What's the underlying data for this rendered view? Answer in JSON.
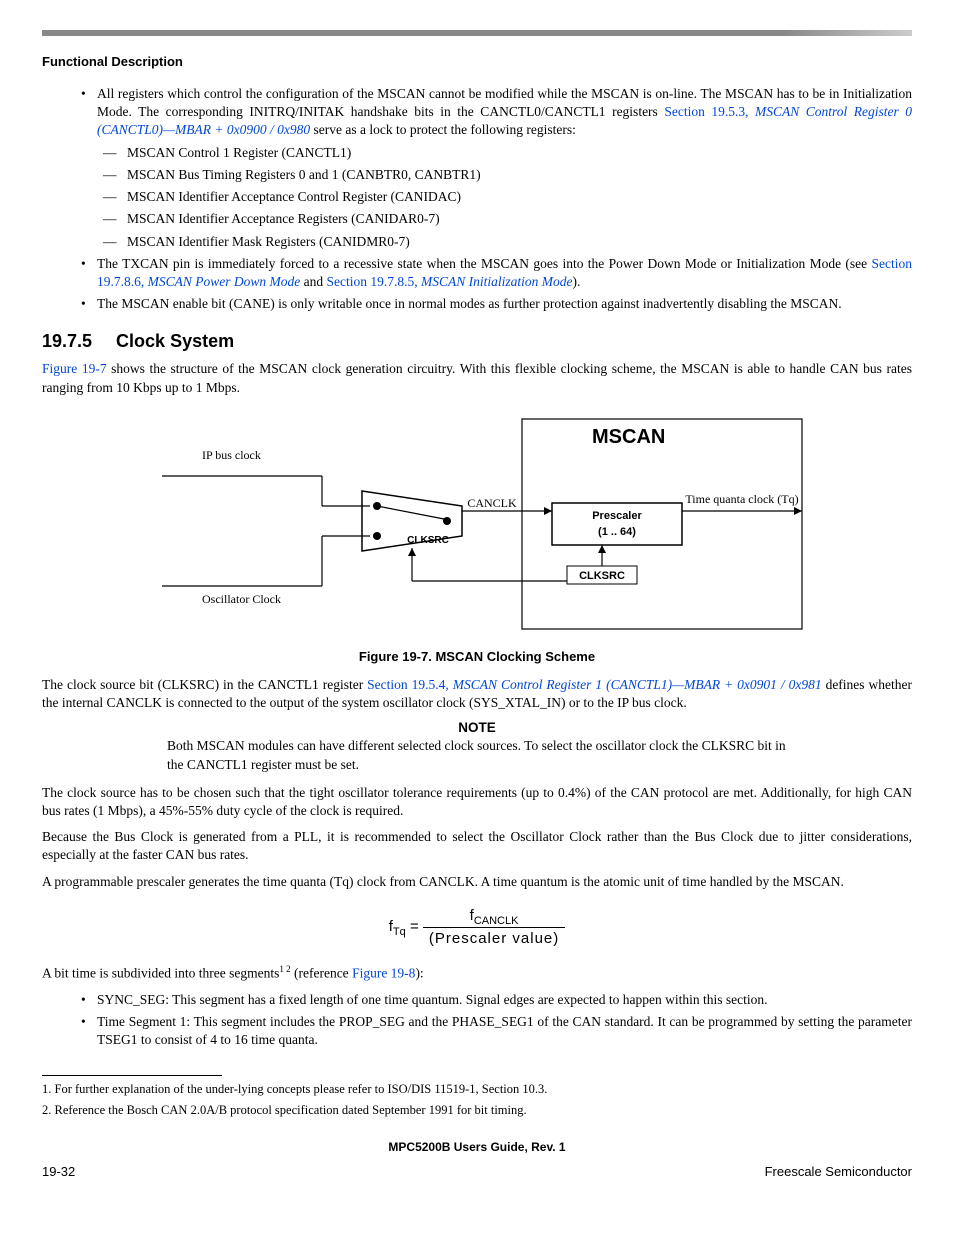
{
  "running_head": "Functional Description",
  "bullets": {
    "b1_pre": "All registers which control the configuration of the MSCAN cannot be modified while the MSCAN is on-line. The MSCAN has to be in Initialization Mode. The corresponding INITRQ/INITAK handshake bits in the CANCTL0/CANCTL1 registers ",
    "b1_link1": "Section 19.5.3, ",
    "b1_link1_ital": "MSCAN Control Register 0 (CANCTL0)—MBAR + 0x0900 / 0x980",
    "b1_post": " serve as a lock to protect the following registers:",
    "s1": "MSCAN Control 1 Register (CANCTL1)",
    "s2": "MSCAN Bus Timing Registers 0 and 1 (CANBTR0, CANBTR1)",
    "s3": "MSCAN Identifier Acceptance Control Register (CANIDAC)",
    "s4": "MSCAN Identifier Acceptance Registers (CANIDAR0-7)",
    "s5": "MSCAN Identifier Mask Registers (CANIDMR0-7)",
    "b2_pre": "The TXCAN pin is immediately forced to a recessive state when the MSCAN goes into the Power Down Mode or Initialization Mode (see ",
    "b2_link1": "Section 19.7.8.6, ",
    "b2_link1_ital": "MSCAN Power Down Mode",
    "b2_mid": " and ",
    "b2_link2": "Section 19.7.8.5, ",
    "b2_link2_ital": "MSCAN Initialization Mode",
    "b2_post": ").",
    "b3": "The MSCAN enable bit (CANE) is only writable once in normal modes as further protection against inadvertently disabling the MSCAN."
  },
  "section": {
    "num": "19.7.5",
    "title": "Clock System"
  },
  "para1_link": "Figure 19-7",
  "para1_rest": " shows the structure of the MSCAN clock generation circuitry. With this flexible clocking scheme, the MSCAN is able to handle CAN bus rates ranging from 10 Kbps up to 1 Mbps.",
  "figure": {
    "ip_bus": "IP bus clock",
    "osc": "Oscillator Clock",
    "mscan": "MSCAN",
    "canclk": "CANCLK",
    "clksrc1": "CLKSRC",
    "clksrc2": "CLKSRC",
    "prescaler1": "Prescaler",
    "prescaler2": "(1 .. 64)",
    "tq": "Time quanta clock (Tq)",
    "caption": "Figure 19-7. MSCAN Clocking Scheme"
  },
  "para2_pre": "The clock source bit (CLKSRC) in the CANCTL1 register ",
  "para2_link": "Section 19.5.4, ",
  "para2_link_ital": "MSCAN Control Register 1 (CANCTL1)—MBAR + 0x0901 / 0x981",
  "para2_post": " defines whether the internal CANCLK is connected to the output of the system oscillator clock (SYS_XTAL_IN) or to the IP bus clock.",
  "note_head": "NOTE",
  "note_body": "Both MSCAN modules can have different selected clock sources. To select the oscillator clock the CLKSRC bit in the CANCTL1 register must be set.",
  "para3": "The clock source has to be chosen such that the tight oscillator tolerance requirements (up to 0.4%) of the CAN protocol are met. Additionally, for high CAN bus rates (1 Mbps), a 45%-55% duty cycle of the clock is required.",
  "para4": "Because the Bus Clock is generated from a PLL, it is recommended to select the Oscillator Clock rather than the Bus Clock due to jitter considerations, especially at the faster CAN bus rates.",
  "para5": "A programmable prescaler generates the time quanta (Tq) clock from CANCLK. A time quantum is the atomic unit of time handled by the MSCAN.",
  "formula": {
    "lhs_f": "f",
    "lhs_sub": "Tq",
    "eq": "=",
    "num_f": "f",
    "num_sub": "CANCLK",
    "den": "(Prescaler   value)"
  },
  "para6_pre": "A bit time is subdivided into three segments",
  "para6_mid": " (reference ",
  "para6_link": "Figure 19-8",
  "para6_post": "):",
  "bl1": "SYNC_SEG: This segment has a fixed length of one time quantum. Signal edges are expected to happen within this section.",
  "bl2": "Time Segment 1: This segment includes the PROP_SEG and the PHASE_SEG1 of the CAN standard. It can be programmed by setting the parameter TSEG1 to consist of 4 to 16 time quanta.",
  "fn1": "1. For further explanation of the under-lying concepts please refer to ISO/DIS 11519-1, Section 10.3.",
  "fn2": "2. Reference the Bosch CAN 2.0A/B protocol specification dated September 1991 for bit timing.",
  "footer_center": "MPC5200B Users Guide, Rev. 1",
  "footer_left": "19-32",
  "footer_right": "Freescale Semiconductor"
}
